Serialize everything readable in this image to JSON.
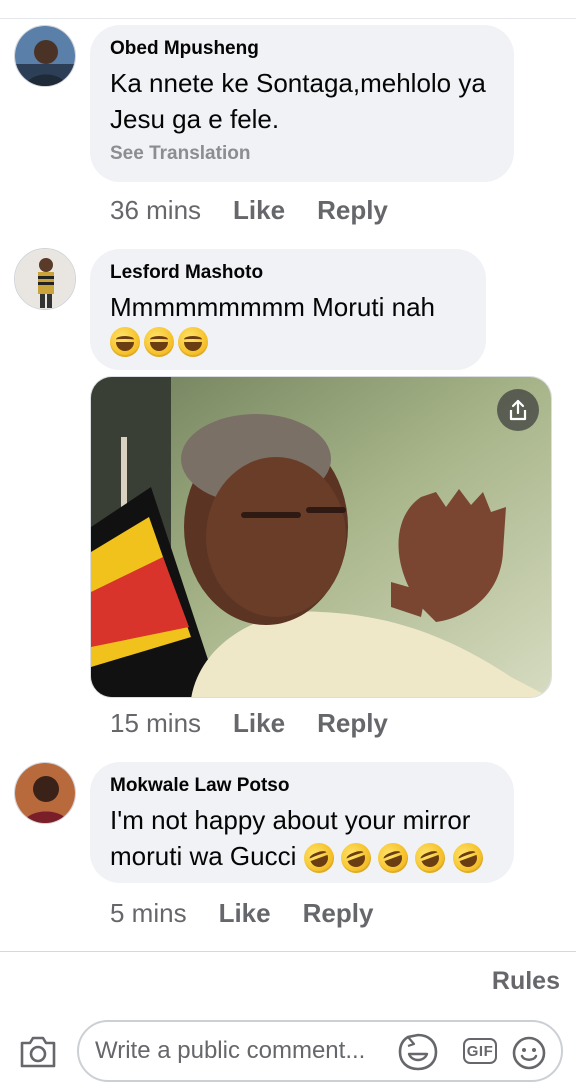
{
  "comments": [
    {
      "author": "Obed Mpusheng",
      "text": "Ka nnete ke Sontaga,mehlolo ya Jesu ga e fele.",
      "see_translation": "See Translation",
      "time": "36 mins",
      "like": "Like",
      "reply": "Reply"
    },
    {
      "author": "Lesford Mashoto",
      "text": "Mmmmmmmmm Moruti nah",
      "emojis": [
        "grinning-sweat-emoji",
        "grinning-sweat-emoji",
        "grinning-sweat-emoji"
      ],
      "time": "15 mins",
      "like": "Like",
      "reply": "Reply"
    },
    {
      "author": "Mokwale Law Potso",
      "text": "I'm not happy about your mirror moruti wa Gucci",
      "emojis": [
        "rolling-laughing-emoji",
        "rolling-laughing-emoji",
        "rolling-laughing-emoji",
        "rolling-laughing-emoji",
        "rolling-laughing-emoji"
      ],
      "time": "5 mins",
      "like": "Like",
      "reply": "Reply"
    }
  ],
  "footer": {
    "rules": "Rules",
    "composer_placeholder": "Write a public comment...",
    "gif": "GIF"
  },
  "colors": {
    "bubble": "#f0f2f5",
    "muted_text": "#65676b",
    "emoji_yellow": "#f7c531"
  },
  "icons": [
    "camera-icon",
    "sticker-icon",
    "gif-icon",
    "smiley-icon",
    "share-icon"
  ]
}
